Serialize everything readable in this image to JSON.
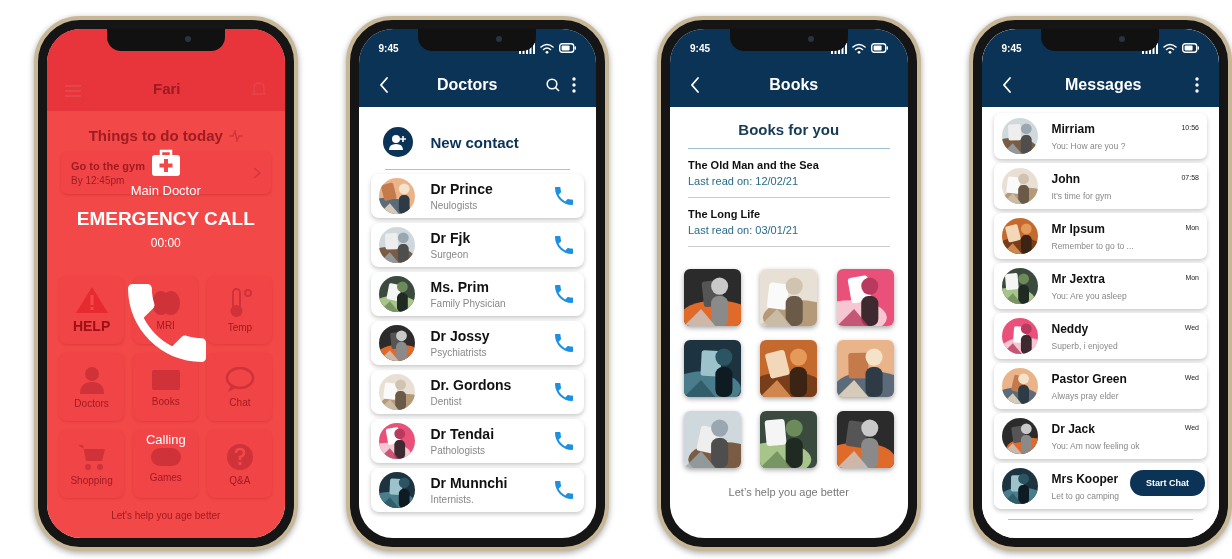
{
  "emergency_screen": {
    "app_title": "Fari",
    "section_title": "Things to do today",
    "tasks": [
      {
        "title": "Go to the gym",
        "due": "By 12:45pm"
      }
    ],
    "tiles": [
      {
        "label": "HELP",
        "kind": "help"
      },
      {
        "label": "MRI",
        "kind": "mri"
      },
      {
        "label": "Temp",
        "kind": "temp"
      },
      {
        "label": "Doctors",
        "kind": "doctors"
      },
      {
        "label": "Books",
        "kind": "books"
      },
      {
        "label": "Chat",
        "kind": "chat"
      },
      {
        "label": "Shopping",
        "kind": "shopping"
      },
      {
        "label": "Games",
        "kind": "games"
      },
      {
        "label": "Q&A",
        "kind": "qa"
      }
    ],
    "footer": "Let's help you age better",
    "call": {
      "caller": "Main Doctor",
      "title": "EMERGENCY CALL",
      "timer": "00:00",
      "status": "Calling"
    }
  },
  "doctors_screen": {
    "status_time": "9:45",
    "title": "Doctors",
    "new_contact": "New contact",
    "doctors": [
      {
        "name": "Dr Prince",
        "specialty": "Neulogists"
      },
      {
        "name": "Dr Fjk",
        "specialty": "Surgeon"
      },
      {
        "name": "Ms. Prim",
        "specialty": "Family Physician"
      },
      {
        "name": "Dr Jossy",
        "specialty": "Psychiatrists"
      },
      {
        "name": "Dr. Gordons",
        "specialty": "Dentist"
      },
      {
        "name": "Dr Tendai",
        "specialty": "Pathologists"
      },
      {
        "name": "Dr Munnchi",
        "specialty": "Internists."
      }
    ]
  },
  "books_screen": {
    "status_time": "9:45",
    "title": "Books",
    "heading": "Books for you",
    "recent": [
      {
        "title": "The Old Man and the Sea",
        "last_read": "Last read on: 12/02/21"
      },
      {
        "title": "The Long Life",
        "last_read": "Last read on: 03/01/21"
      }
    ],
    "footer": "Let’s help you age better"
  },
  "messages_screen": {
    "status_time": "9:45",
    "title": "Messages",
    "chats": [
      {
        "name": "Mirriam",
        "preview": "You:  How are you ?",
        "time": "10:56"
      },
      {
        "name": "John",
        "preview": "It's time for gym",
        "time": "07:58"
      },
      {
        "name": "Mr Ipsum",
        "preview": "Remember to go to ...",
        "time": "Mon"
      },
      {
        "name": "Mr Jextra",
        "preview": "You: Are you asleep",
        "time": "Mon"
      },
      {
        "name": "Neddy",
        "preview": "Superb, i enjoyed",
        "time": "Wed"
      },
      {
        "name": "Pastor Green",
        "preview": "Always pray elder",
        "time": "Wed"
      },
      {
        "name": "Dr Jack",
        "preview": "You: Am now feeling ok",
        "time": "Wed"
      },
      {
        "name": "Mrs Kooper",
        "preview": "Let to  go camping"
      }
    ],
    "start_button": "Start Chat"
  }
}
